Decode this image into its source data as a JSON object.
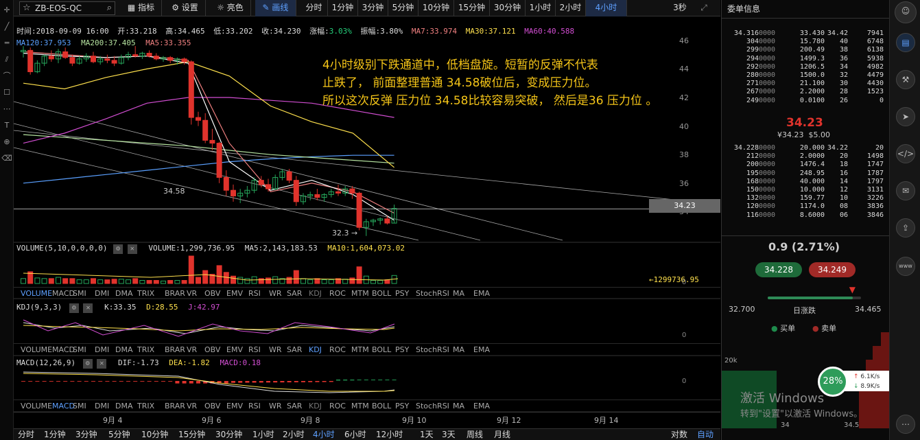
{
  "toolbar": {
    "symbol": "ZB-EOS-QC",
    "indicator": "指标",
    "settings": "设置",
    "bright": "亮色",
    "draw": "画线",
    "periods": [
      "分时",
      "1分钟",
      "3分钟",
      "5分钟",
      "10分钟",
      "15分钟",
      "30分钟",
      "1小时",
      "2小时",
      "4小时"
    ],
    "refresh": "3秒"
  },
  "ohlc": {
    "time": "时间:2018-09-09 16:00",
    "open": "开:33.218",
    "high": "高:34.465",
    "low": "低:33.202",
    "close": "收:34.230",
    "chg_label": "涨幅:",
    "chg": "3.03%",
    "amp": "振幅:3.80%",
    "ma7": "MA7:33.974",
    "ma30": "MA30:37.121",
    "ma60": "MA60:40.588"
  },
  "ma_row2": {
    "ma120": "MA120:37.953",
    "ma200": "MA200:37.405",
    "ma5": "MA5:33.355"
  },
  "annotation": [
    "4小时级别下跌通道中，低档盘旋。短暂的反弹不代表",
    "止跌了， 前面整理普通 34.58破位后，变成压力位。",
    "所以这次反弹 压力位 34.58比较容易突破， 然后是36 压力位 。"
  ],
  "chart_labels": {
    "line_label": "34.58",
    "low_label": "32.3 →",
    "price_tag": "34.23"
  },
  "price_axis": [
    "46",
    "44",
    "42",
    "40",
    "38",
    "36",
    "34"
  ],
  "volume_pane": {
    "title": "VOLUME(5,10,0,0,0,0)",
    "vol": "VOLUME:1,299,736.95",
    "ma5": "MA5:2,143,183.53",
    "ma10": "MA10:1,604,073.02",
    "last": "←1299736.95",
    "zero": "0"
  },
  "indicator_tabs": [
    "VOLUME",
    "MACD",
    "SMI",
    "DMI",
    "DMA",
    "TRIX",
    "BRAR",
    "VR",
    "OBV",
    "EMV",
    "RSI",
    "WR",
    "SAR",
    "KDJ",
    "ROC",
    "MTM",
    "BOLL",
    "PSY",
    "StochRSI",
    "MA",
    "EMA"
  ],
  "kdj_pane": {
    "title": "KDJ(9,3,3)",
    "k": "K:33.35",
    "d": "D:28.55",
    "j": "J:42.97",
    "zero": "0"
  },
  "macd_pane": {
    "title": "MACD(12,26,9)",
    "dif": "DIF:-1.73",
    "dea": "DEA:-1.82",
    "macd": "MACD:0.18",
    "zero": "0"
  },
  "date_axis": [
    "9月 4",
    "9月 6",
    "9月 8",
    "9月 10",
    "9月 12",
    "9月 14"
  ],
  "bottom_tabs": [
    "分时",
    "1分钟",
    "3分钟",
    "5分钟",
    "10分钟",
    "15分钟",
    "30分钟",
    "1小时",
    "2小时",
    "4小时",
    "6小时",
    "12小时",
    "1天",
    "3天",
    "周线",
    "月线"
  ],
  "bottom_right": [
    "对数",
    "自动"
  ],
  "order_book": {
    "title": "委单信息",
    "asks": [
      [
        "34.316",
        "0000",
        "33.430",
        "34.42",
        "7941"
      ],
      [
        "304",
        "0000",
        "15.780",
        "40",
        "6748"
      ],
      [
        "299",
        "0000",
        "200.49",
        "38",
        "6138"
      ],
      [
        "294",
        "0000",
        "1499.3",
        "36",
        "5938"
      ],
      [
        "292",
        "0000",
        "1206.5",
        "34",
        "4982"
      ],
      [
        "280",
        "0000",
        "1500.0",
        "32",
        "4479"
      ],
      [
        "271",
        "0000",
        "21.100",
        "30",
        "4430"
      ],
      [
        "267",
        "0000",
        "2.2000",
        "28",
        "1523"
      ],
      [
        "249",
        "0000",
        "0.0100",
        "26",
        "0"
      ]
    ],
    "last_price": "34.23",
    "last_sub": "¥34.23  $5.00",
    "bids": [
      [
        "34.228",
        "0000",
        "20.000",
        "34.22",
        "20"
      ],
      [
        "212",
        "0000",
        "2.0000",
        "20",
        "1498"
      ],
      [
        "200",
        "0000",
        "1476.4",
        "18",
        "1747"
      ],
      [
        "195",
        "0000",
        "248.95",
        "16",
        "1787"
      ],
      [
        "168",
        "0000",
        "40.000",
        "14",
        "1797"
      ],
      [
        "150",
        "0000",
        "10.000",
        "12",
        "3131"
      ],
      [
        "132",
        "0000",
        "159.77",
        "10",
        "3226"
      ],
      [
        "120",
        "0000",
        "1174.0",
        "08",
        "3836"
      ],
      [
        "116",
        "0000",
        "8.6000",
        "06",
        "3846"
      ]
    ]
  },
  "ticker": {
    "change": "0.9",
    "pct": "(2.71%)",
    "buy": "34.228",
    "sell": "34.249",
    "low": "32.700",
    "range_label": "日涨跌",
    "high": "34.465",
    "range_pos": 0.91,
    "legend_buy": "买单",
    "legend_sell": "卖单"
  },
  "depth": {
    "y_label": "20k",
    "x_labels": [
      "34",
      "34.5"
    ]
  },
  "netspeed": {
    "percent": "28%",
    "up": "6.1K/s",
    "down": "8.9K/s"
  },
  "watermark": {
    "line1": "激活 Windows",
    "line2": "转到\"设置\"以激活 Windows。"
  },
  "colors": {
    "up": "#26a65b",
    "down": "#e0332c",
    "ma5": "#ffffff",
    "ma7": "#f08080",
    "ma30": "#ffe14d",
    "ma60": "#d24ed2",
    "ma120": "#5aa0ff",
    "ma200": "#b6e3a0",
    "annotation": "#f5c518"
  },
  "chart_data": {
    "type": "candlestick",
    "x_ticks": [
      "9月 4",
      "9月 6",
      "9月 8",
      "9月 10",
      "9月 12",
      "9月 14"
    ],
    "ylim": [
      32.0,
      47.0
    ],
    "candles": [
      [
        45.2,
        45.6,
        44.8,
        45.3
      ],
      [
        45.3,
        45.5,
        43.6,
        43.8
      ],
      [
        43.8,
        44.6,
        43.7,
        44.4
      ],
      [
        44.4,
        45.0,
        44.2,
        44.9
      ],
      [
        44.9,
        45.3,
        44.5,
        44.7
      ],
      [
        44.7,
        45.4,
        44.4,
        45.2
      ],
      [
        45.2,
        45.5,
        44.7,
        44.8
      ],
      [
        44.8,
        45.0,
        44.2,
        44.4
      ],
      [
        44.4,
        44.9,
        44.3,
        44.7
      ],
      [
        44.7,
        45.1,
        44.5,
        44.9
      ],
      [
        44.9,
        45.2,
        44.4,
        44.5
      ],
      [
        44.5,
        44.9,
        44.3,
        44.7
      ],
      [
        44.7,
        45.0,
        44.4,
        44.6
      ],
      [
        44.6,
        44.9,
        44.2,
        44.4
      ],
      [
        44.4,
        45.0,
        44.3,
        44.8
      ],
      [
        44.8,
        45.2,
        44.6,
        45.0
      ],
      [
        45.0,
        45.6,
        44.8,
        44.9
      ],
      [
        44.9,
        45.2,
        44.7,
        45.1
      ],
      [
        45.1,
        45.3,
        44.8,
        44.9
      ],
      [
        44.9,
        45.1,
        44.6,
        44.7
      ],
      [
        44.7,
        44.9,
        44.5,
        44.8
      ],
      [
        44.8,
        44.9,
        44.4,
        44.6
      ],
      [
        44.6,
        44.8,
        44.3,
        44.7
      ],
      [
        44.7,
        44.8,
        44.3,
        44.5
      ],
      [
        44.5,
        44.6,
        40.1,
        40.6
      ],
      [
        40.6,
        41.0,
        40.0,
        40.4
      ],
      [
        40.4,
        40.9,
        38.8,
        39.0
      ],
      [
        39.0,
        39.8,
        38.3,
        38.8
      ],
      [
        38.8,
        38.9,
        36.0,
        36.4
      ],
      [
        36.4,
        36.9,
        35.1,
        35.5
      ],
      [
        35.5,
        35.9,
        34.7,
        35.1
      ],
      [
        35.1,
        35.6,
        34.6,
        35.3
      ],
      [
        35.3,
        35.8,
        35.0,
        35.5
      ],
      [
        35.5,
        36.4,
        35.3,
        36.2
      ],
      [
        36.2,
        36.5,
        35.7,
        35.9
      ],
      [
        35.9,
        36.3,
        35.4,
        35.6
      ],
      [
        35.6,
        36.6,
        35.5,
        36.4
      ],
      [
        36.4,
        37.0,
        36.2,
        36.8
      ],
      [
        36.8,
        37.0,
        36.0,
        36.2
      ],
      [
        36.2,
        36.5,
        34.4,
        34.7
      ],
      [
        34.7,
        35.3,
        34.5,
        35.1
      ],
      [
        35.1,
        35.4,
        34.8,
        35.2
      ],
      [
        35.2,
        35.6,
        34.8,
        35.0
      ],
      [
        35.0,
        35.3,
        34.7,
        35.2
      ],
      [
        35.2,
        35.6,
        35.0,
        35.4
      ],
      [
        35.4,
        35.9,
        35.1,
        35.3
      ],
      [
        35.3,
        35.8,
        35.1,
        35.6
      ],
      [
        35.6,
        35.8,
        34.9,
        35.3
      ],
      [
        35.3,
        35.4,
        32.7,
        32.9
      ],
      [
        32.9,
        33.5,
        32.3,
        33.3
      ],
      [
        33.3,
        33.5,
        33.0,
        33.4
      ],
      [
        33.4,
        33.6,
        33.1,
        33.5
      ],
      [
        33.5,
        33.7,
        33.1,
        33.2
      ],
      [
        33.2,
        34.5,
        33.2,
        34.23
      ]
    ],
    "volume_ma5": 2143183.53,
    "volume_ma10": 1604073.02,
    "last_volume": 1299736.95,
    "level_34_58": 34.58
  }
}
